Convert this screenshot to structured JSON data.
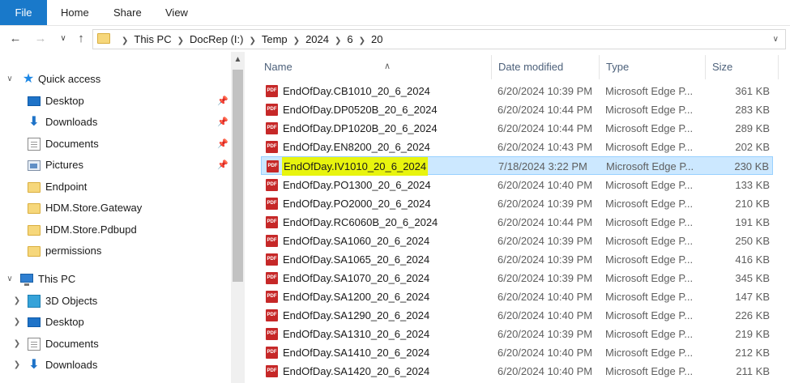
{
  "ribbon": {
    "tabs": [
      "File",
      "Home",
      "Share",
      "View"
    ]
  },
  "address": {
    "crumbs": [
      "This PC",
      "DocRep (I:)",
      "Temp",
      "2024",
      "6",
      "20"
    ]
  },
  "nav": {
    "quick_access": "Quick access",
    "quick_items": [
      "Desktop",
      "Downloads",
      "Documents",
      "Pictures",
      "Endpoint",
      "HDM.Store.Gateway",
      "HDM.Store.Pdbupd",
      "permissions"
    ],
    "this_pc": "This PC",
    "pc_items": [
      "3D Objects",
      "Desktop",
      "Documents",
      "Downloads"
    ]
  },
  "columns": {
    "name": "Name",
    "date": "Date modified",
    "type": "Type",
    "size": "Size"
  },
  "files": [
    {
      "name": "EndOfDay.CB1010_20_6_2024",
      "date": "6/20/2024 10:39 PM",
      "type": "Microsoft Edge P...",
      "size": "361 KB"
    },
    {
      "name": "EndOfDay.DP0520B_20_6_2024",
      "date": "6/20/2024 10:44 PM",
      "type": "Microsoft Edge P...",
      "size": "283 KB"
    },
    {
      "name": "EndOfDay.DP1020B_20_6_2024",
      "date": "6/20/2024 10:44 PM",
      "type": "Microsoft Edge P...",
      "size": "289 KB"
    },
    {
      "name": "EndOfDay.EN8200_20_6_2024",
      "date": "6/20/2024 10:43 PM",
      "type": "Microsoft Edge P...",
      "size": "202 KB"
    },
    {
      "name": "EndOfDay.IV1010_20_6_2024",
      "date": "7/18/2024 3:22 PM",
      "type": "Microsoft Edge P...",
      "size": "230 KB"
    },
    {
      "name": "EndOfDay.PO1300_20_6_2024",
      "date": "6/20/2024 10:40 PM",
      "type": "Microsoft Edge P...",
      "size": "133 KB"
    },
    {
      "name": "EndOfDay.PO2000_20_6_2024",
      "date": "6/20/2024 10:39 PM",
      "type": "Microsoft Edge P...",
      "size": "210 KB"
    },
    {
      "name": "EndOfDay.RC6060B_20_6_2024",
      "date": "6/20/2024 10:44 PM",
      "type": "Microsoft Edge P...",
      "size": "191 KB"
    },
    {
      "name": "EndOfDay.SA1060_20_6_2024",
      "date": "6/20/2024 10:39 PM",
      "type": "Microsoft Edge P...",
      "size": "250 KB"
    },
    {
      "name": "EndOfDay.SA1065_20_6_2024",
      "date": "6/20/2024 10:39 PM",
      "type": "Microsoft Edge P...",
      "size": "416 KB"
    },
    {
      "name": "EndOfDay.SA1070_20_6_2024",
      "date": "6/20/2024 10:39 PM",
      "type": "Microsoft Edge P...",
      "size": "345 KB"
    },
    {
      "name": "EndOfDay.SA1200_20_6_2024",
      "date": "6/20/2024 10:40 PM",
      "type": "Microsoft Edge P...",
      "size": "147 KB"
    },
    {
      "name": "EndOfDay.SA1290_20_6_2024",
      "date": "6/20/2024 10:40 PM",
      "type": "Microsoft Edge P...",
      "size": "226 KB"
    },
    {
      "name": "EndOfDay.SA1310_20_6_2024",
      "date": "6/20/2024 10:39 PM",
      "type": "Microsoft Edge P...",
      "size": "219 KB"
    },
    {
      "name": "EndOfDay.SA1410_20_6_2024",
      "date": "6/20/2024 10:40 PM",
      "type": "Microsoft Edge P...",
      "size": "212 KB"
    },
    {
      "name": "EndOfDay.SA1420_20_6_2024",
      "date": "6/20/2024 10:40 PM",
      "type": "Microsoft Edge P...",
      "size": "211 KB"
    }
  ],
  "colors": {
    "file_tab": "#1979ca",
    "selection_bg": "#cce8ff",
    "highlight": "#e8f40e",
    "pdf_icon": "#c62828"
  }
}
